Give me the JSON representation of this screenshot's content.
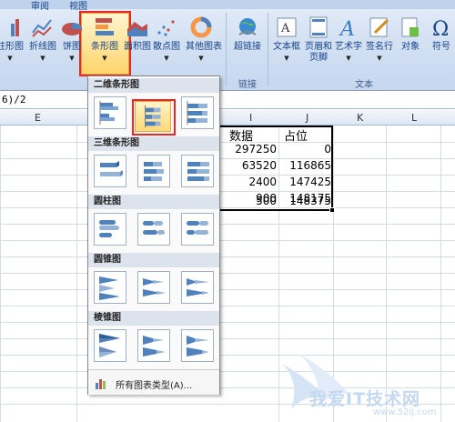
{
  "ribbon": {
    "tabs": [
      "审阅",
      "视图"
    ],
    "buttons": [
      {
        "label": "柱形图"
      },
      {
        "label": "折线图"
      },
      {
        "label": "饼图"
      },
      {
        "label": "条形图"
      },
      {
        "label": "面积图"
      },
      {
        "label": "散点图"
      },
      {
        "label": "其他图表"
      },
      {
        "label": "超链接"
      },
      {
        "label": "文本框"
      },
      {
        "label": "页眉和页脚"
      },
      {
        "label": "艺术字"
      },
      {
        "label": "签名行"
      },
      {
        "label": "对象"
      },
      {
        "label": "符号"
      }
    ],
    "groups": {
      "links": "链接",
      "text": "文本"
    }
  },
  "formula_bar": {
    "text": "6)/2"
  },
  "grid": {
    "columns": [
      "E",
      "I",
      "J",
      "K",
      "L"
    ],
    "header_row": {
      "i": "数据",
      "j": "占位"
    },
    "rows": [
      {
        "i": "297250",
        "j": "0"
      },
      {
        "i": "63520",
        "j": "116865"
      },
      {
        "i": "2400",
        "j": "147425"
      },
      {
        "i": "900",
        "j": "148175"
      },
      {
        "i": "500",
        "j": "148375"
      }
    ]
  },
  "chart_menu": {
    "sections": [
      "二维条形图",
      "三维条形图",
      "圆柱图",
      "圆锥图",
      "棱锥图"
    ],
    "footer": "所有图表类型(A)..."
  },
  "watermark": {
    "text": "我爱IT技术网",
    "url": "www.52ij.com"
  },
  "colors": {
    "highlight": "#e8262a",
    "ribbon": "#d3e1f2",
    "accent": "#15428b"
  }
}
